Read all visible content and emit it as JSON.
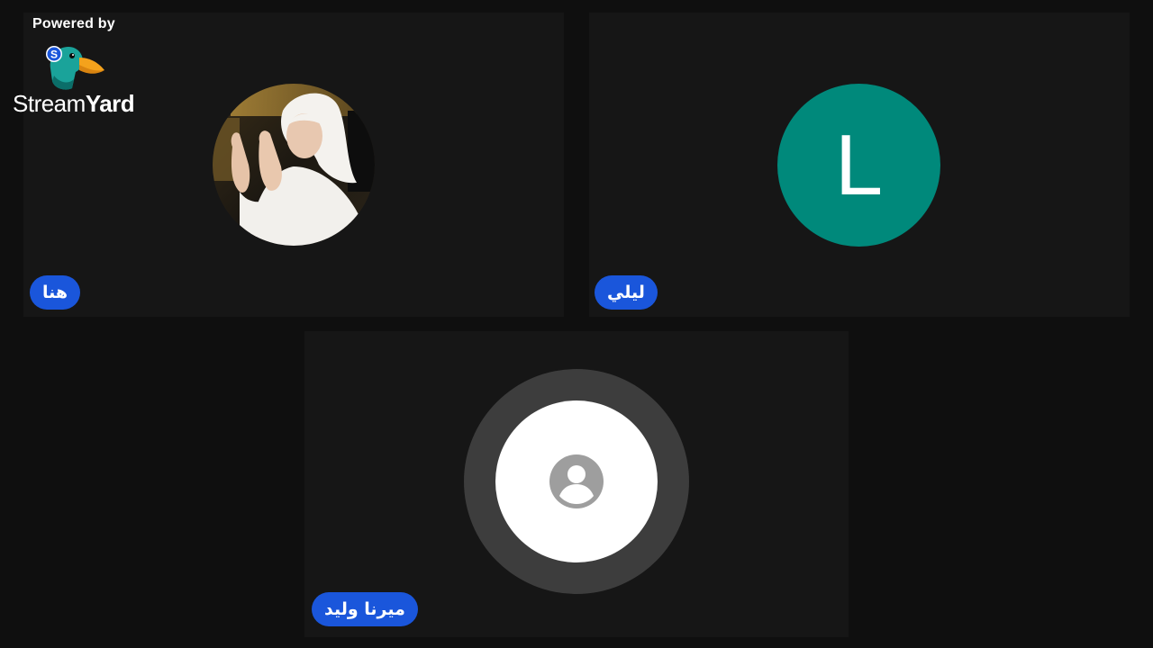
{
  "branding": {
    "powered_by": "Powered by",
    "wordmark_light": "Stream",
    "wordmark_bold": "Yard",
    "duck_badge_letter": "S",
    "logo_icon": "streamyard-duck-icon"
  },
  "participants": [
    {
      "name": "هنا",
      "avatar_type": "photo",
      "avatar_icon": "user-photo"
    },
    {
      "name": "ليلي",
      "avatar_type": "letter",
      "avatar_letter": "L",
      "avatar_color": "#00897b"
    },
    {
      "name": "ميرنا وليد",
      "avatar_type": "placeholder",
      "avatar_icon": "account-circle-icon",
      "ring_color": "#3d3d3d"
    }
  ],
  "colors": {
    "background": "#0f0f0f",
    "tile": "#161616",
    "name_badge": "#1a56db"
  }
}
